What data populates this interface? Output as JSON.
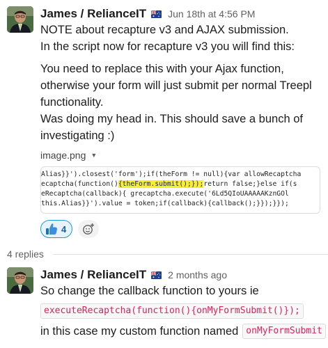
{
  "message1": {
    "author": "James / RelianceIT",
    "flag_icon": "australia-flag-icon",
    "time": "Jun 18th at 4:56 PM",
    "lines": [
      "NOTE about recapture v3 and AJAX submission.",
      "In the script now for recapture v3 you will find this:"
    ],
    "para2": [
      "You need to replace this with your Ajax function,",
      "otherwise your form will just submit per normal Treepl",
      "functionality.",
      "Was doing my head in. This should save a bunch of",
      "investigating :)"
    ],
    "attachment": {
      "filename": "image.png",
      "caret_icon": "chevron-down-icon",
      "code_lines": [
        {
          "pre": "Alias}}').closest('form');if(theForm != null){var allowRecaptcha",
          "hl": "",
          "post": ""
        },
        {
          "pre": "ecaptcha(function()",
          "hl": "{theForm.submit();});",
          "post": "return false;}else if(s"
        },
        {
          "pre": "eRecaptcha(callback){   grecaptcha.execute('6Ld5QIoUAAAAAKznGOl",
          "hl": "",
          "post": ""
        },
        {
          "pre": "this.Alias}}').value = token;if(callback){callback();}});}});",
          "hl": "",
          "post": ""
        }
      ]
    },
    "reactions": [
      {
        "emoji": "thumbs-up-icon",
        "count": "4"
      }
    ],
    "add_reaction_icon": "add-reaction-icon"
  },
  "thread": {
    "replies_label": "4 replies"
  },
  "message2": {
    "author": "James / RelianceIT",
    "flag_icon": "australia-flag-icon",
    "time": "2 months ago",
    "line1": "So change the callback function to yours ie",
    "code_block": "executeRecaptcha(function(){onMyFormSubmit()});",
    "line2": "in this case my custom function named",
    "inline_code": "onMyFormSubmit"
  },
  "colors": {
    "link_blue": "#1264a3",
    "code_red": "#e01e5a",
    "highlight_yellow": "#f7f028",
    "reaction_bg": "#e8f2fb"
  }
}
